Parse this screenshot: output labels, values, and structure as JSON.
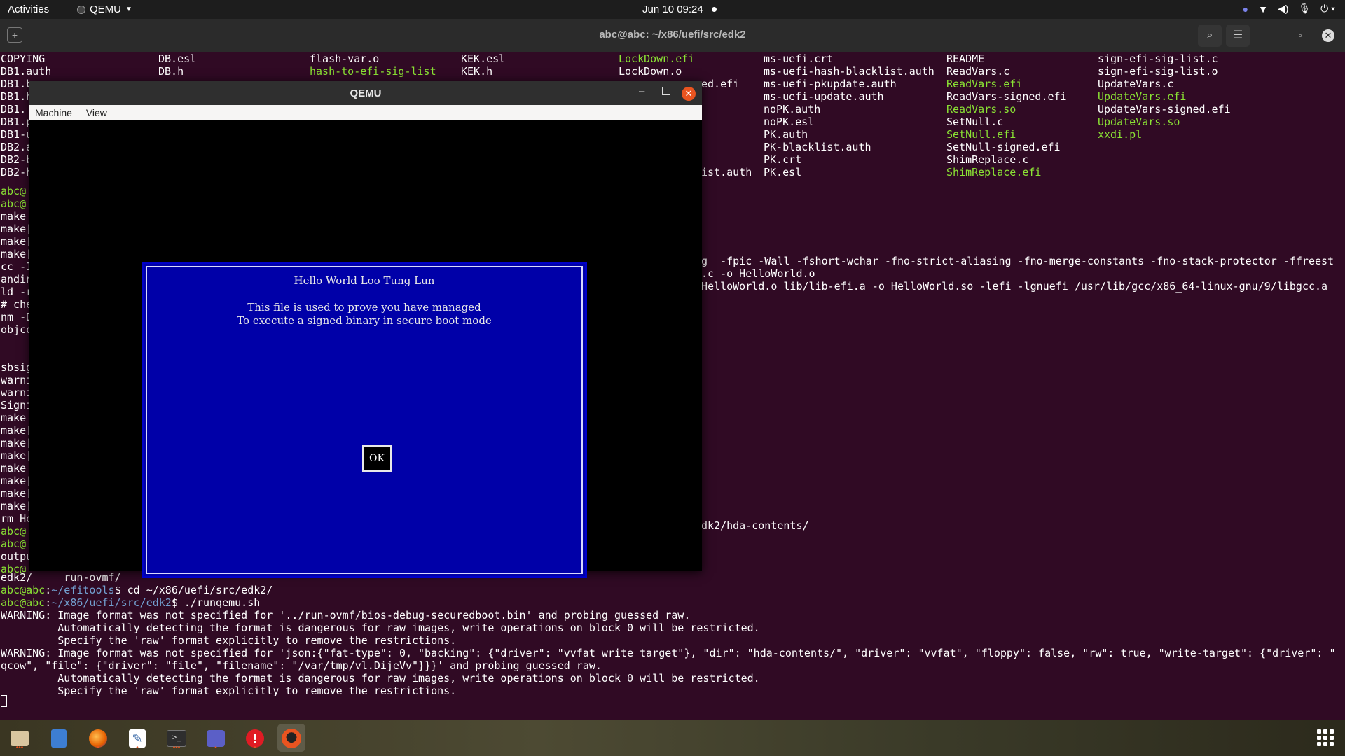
{
  "topbar": {
    "activities": "Activities",
    "app_menu": "QEMU",
    "clock": "Jun 10  09:24"
  },
  "terminal": {
    "title": "abc@abc: ~/x86/uefi/src/edk2",
    "listing_rows": [
      [
        "COPYING",
        "DB.esl",
        "flash-var.o",
        "KEK.esl",
        "LockDown.efi",
        "ms-uefi.crt",
        "README",
        "sign-efi-sig-list.c"
      ],
      [
        "DB1.auth",
        "DB.h",
        "hash-to-efi-sig-list",
        "KEK.h",
        "LockDown.o",
        "ms-uefi-hash-blacklist.auth",
        "ReadVars.c",
        "sign-efi-sig-list.o"
      ],
      [
        "DB1.b",
        "",
        "",
        "",
        "ed.efi",
        "ms-uefi-pkupdate.auth",
        "ReadVars.efi",
        "UpdateVars.c"
      ],
      [
        "DB1.h",
        "",
        "",
        "",
        "",
        "ms-uefi-update.auth",
        "ReadVars-signed.efi",
        "UpdateVars.efi"
      ],
      [
        "DB1.",
        "",
        "",
        "",
        "",
        "noPK.auth",
        "ReadVars.so",
        "UpdateVars-signed.efi"
      ],
      [
        "DB1.p",
        "",
        "",
        "",
        "",
        "noPK.esl",
        "SetNull.c",
        "UpdateVars.so"
      ],
      [
        "DB1-u",
        "",
        "",
        "",
        "",
        "PK.auth",
        "SetNull.efi",
        "xxdi.pl"
      ],
      [
        "DB2.a",
        "",
        "",
        "",
        "",
        "PK-blacklist.auth",
        "SetNull-signed.efi",
        ""
      ],
      [
        "DB2-b",
        "",
        "",
        "",
        "",
        "PK.crt",
        "ShimReplace.c",
        ""
      ],
      [
        "DB2-h",
        "",
        "",
        "",
        "ist.auth",
        "PK.esl",
        "ShimReplace.efi",
        ""
      ]
    ],
    "left_fragments": [
      "abc@",
      "abc@",
      "make",
      "make[",
      "make[",
      "make[",
      "cc -I",
      "andin",
      "ld -r",
      "# che",
      "nm -D",
      "objco",
      "",
      "",
      "sbsig",
      "warni",
      "warni",
      "Signi",
      "make",
      "make[",
      "make[",
      "make[",
      "make",
      "make[",
      "make[",
      "make[",
      "rm He",
      "abc@",
      "abc@",
      "outpu",
      "abc@"
    ],
    "right_fragments": {
      "cc": "g  -fpic -Wall -fshort-wchar -fno-strict-aliasing -fno-merge-constants -fno-stack-protector -ffreest",
      "andin": ".c -o HelloWorld.o",
      "ld": "HelloWorld.o lib/lib-efi.a -o HelloWorld.so -lefi -lgnuefi /usr/lib/gcc/x86_64-linux-gnu/9/libgcc.a",
      "hda": "dk2/hda-contents/"
    },
    "tail_lines": {
      "edk2": "edk2/     run-ovmf/",
      "cmd1_user": "abc@abc",
      "cmd1_path": "~/efitools",
      "cmd1": "$ cd ~/x86/uefi/src/edk2/",
      "cmd2_user": "abc@abc",
      "cmd2_path": "~/x86/uefi/src/edk2",
      "cmd2": "$ ./runqemu.sh",
      "w1": "WARNING: Image format was not specified for '../run-ovmf/bios-debug-securedboot.bin' and probing guessed raw.",
      "w2": "         Automatically detecting the format is dangerous for raw images, write operations on block 0 will be restricted.",
      "w3": "         Specify the 'raw' format explicitly to remove the restrictions.",
      "w4": "WARNING: Image format was not specified for 'json:{\"fat-type\": 0, \"backing\": {\"driver\": \"vvfat_write_target\"}, \"dir\": \"hda-contents/\", \"driver\": \"vvfat\", \"floppy\": false, \"rw\": true, \"write-target\": {\"driver\": \"",
      "w5": "qcow\", \"file\": {\"driver\": \"file\", \"filename\": \"/var/tmp/vl.DijeVv\"}}}' and probing guessed raw.",
      "w6": "         Automatically detecting the format is dangerous for raw images, write operations on block 0 will be restricted.",
      "w7": "         Specify the 'raw' format explicitly to remove the restrictions."
    }
  },
  "qemu": {
    "title": "QEMU",
    "menu_machine": "Machine",
    "menu_view": "View",
    "dialog_title": "Hello World Loo Tung Lun",
    "dialog_line1": "This file is used to prove you have managed",
    "dialog_line2": "To execute a signed binary in secure boot mode",
    "ok_label": "OK"
  },
  "colors": {
    "terminal_bg": "#300a24",
    "executable_green": "#8ae234",
    "path_blue": "#729fcf",
    "dialog_blue": "#0000a8",
    "close_orange": "#e95420"
  },
  "dock_icons": [
    "files-icon",
    "text-editor-icon",
    "firefox-icon",
    "notes-icon",
    "terminal-icon",
    "teams-icon",
    "alert-icon",
    "qemu-icon"
  ]
}
